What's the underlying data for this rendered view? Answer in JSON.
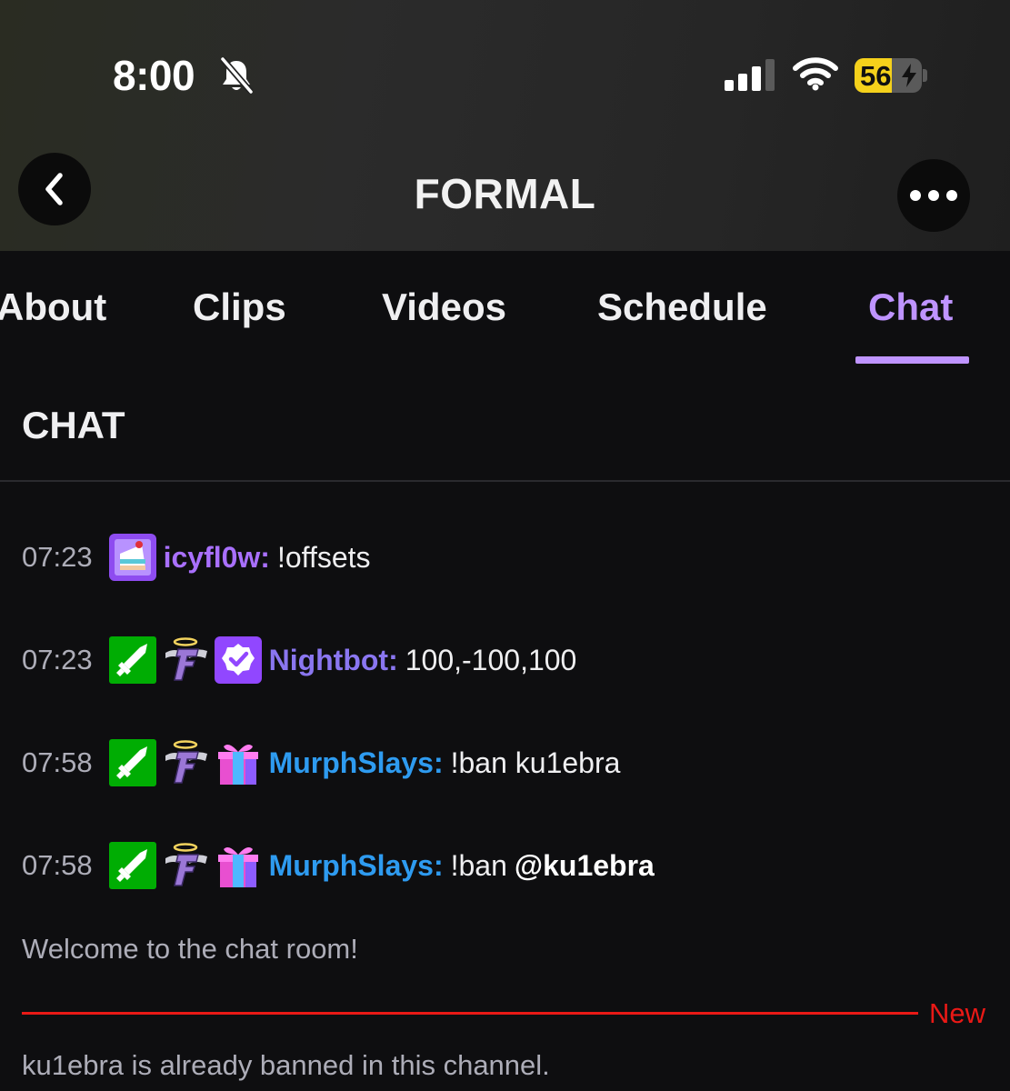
{
  "status_bar": {
    "time": "8:00",
    "battery_percent": "56",
    "battery_level": 0.56,
    "icons": [
      "bell-slash-icon",
      "cellular-signal-icon",
      "wifi-icon",
      "battery-charging-icon"
    ]
  },
  "header": {
    "title": "FORMAL",
    "back_icon": "chevron-left-icon",
    "more_icon": "more-horizontal-icon"
  },
  "tabs": [
    {
      "label": "About",
      "active": false
    },
    {
      "label": "Clips",
      "active": false
    },
    {
      "label": "Videos",
      "active": false
    },
    {
      "label": "Schedule",
      "active": false
    },
    {
      "label": "Chat",
      "active": true
    }
  ],
  "chat": {
    "heading": "CHAT",
    "messages": [
      {
        "time": "07:23",
        "badges": [
          "cake-badge-icon"
        ],
        "user": "icyfl0w:",
        "user_color": "#a970ff",
        "text": "!offsets",
        "mention": ""
      },
      {
        "time": "07:23",
        "badges": [
          "moderator-sword-badge-icon",
          "winged-f-badge-icon",
          "verified-bot-badge-icon"
        ],
        "user": "Nightbot:",
        "user_color": "#8a76f0",
        "text": "100,-100,100",
        "mention": ""
      },
      {
        "time": "07:58",
        "badges": [
          "moderator-sword-badge-icon",
          "winged-f-badge-icon",
          "gift-badge-icon"
        ],
        "user": "MurphSlays:",
        "user_color": "#2e9bf0",
        "text": "!ban ku1ebra",
        "mention": ""
      },
      {
        "time": "07:58",
        "badges": [
          "moderator-sword-badge-icon",
          "winged-f-badge-icon",
          "gift-badge-icon"
        ],
        "user": "MurphSlays:",
        "user_color": "#2e9bf0",
        "text": "!ban",
        "mention": "@ku1ebra"
      }
    ],
    "welcome": "Welcome to the chat room!",
    "new_label": "New",
    "system_notice": "ku1ebra is already banned in this channel."
  },
  "colors": {
    "accent": "#bf94ff",
    "new_divider": "#e91916",
    "background": "#0e0e10"
  }
}
